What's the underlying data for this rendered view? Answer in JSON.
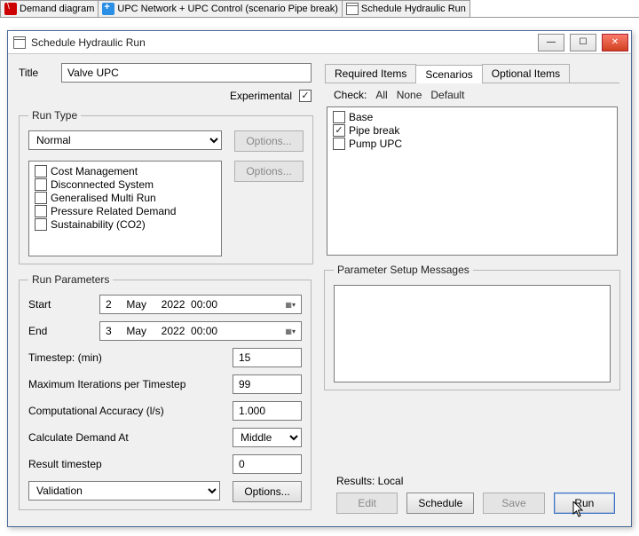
{
  "mdi_tabs": [
    {
      "label": "Demand diagram"
    },
    {
      "label": "UPC Network + UPC Control (scenario Pipe break)"
    },
    {
      "label": "Schedule Hydraulic Run"
    }
  ],
  "window": {
    "title": "Schedule Hydraulic Run"
  },
  "left": {
    "title_label": "Title",
    "title_value": "Valve UPC",
    "experimental_label": "Experimental",
    "experimental_checked": true,
    "run_type_legend": "Run Type",
    "run_type_value": "Normal",
    "options_label": "Options...",
    "run_type_items": [
      {
        "label": "Cost Management",
        "checked": false
      },
      {
        "label": "Disconnected System",
        "checked": false
      },
      {
        "label": "Generalised Multi Run",
        "checked": false
      },
      {
        "label": "Pressure Related Demand",
        "checked": false
      },
      {
        "label": "Sustainability (CO2)",
        "checked": false
      }
    ],
    "run_params_legend": "Run Parameters",
    "start_label": "Start",
    "end_label": "End",
    "start_value": "2     May     2022  00:00",
    "end_value": "3     May     2022  00:00",
    "timestep_label": "Timestep: (min)",
    "timestep_value": "15",
    "maxiter_label": "Maximum Iterations per Timestep",
    "maxiter_value": "99",
    "accuracy_label": "Computational Accuracy (l/s)",
    "accuracy_value": "1.000",
    "calc_demand_label": "Calculate Demand At",
    "calc_demand_value": "Middle",
    "result_ts_label": "Result timestep",
    "result_ts_value": "0",
    "validation_value": "Validation"
  },
  "right": {
    "tabs": [
      {
        "label": "Required Items"
      },
      {
        "label": "Scenarios"
      },
      {
        "label": "Optional Items"
      }
    ],
    "active_tab": "Scenarios",
    "check_label": "Check:",
    "check_all": "All",
    "check_none": "None",
    "check_default": "Default",
    "scenarios": [
      {
        "label": "Base",
        "checked": false
      },
      {
        "label": "Pipe break",
        "checked": true
      },
      {
        "label": "Pump UPC",
        "checked": false
      }
    ],
    "msg_legend": "Parameter Setup Messages",
    "results_label": "Results: Local",
    "edit_label": "Edit",
    "schedule_label": "Schedule",
    "save_label": "Save",
    "run_label": "Run"
  }
}
